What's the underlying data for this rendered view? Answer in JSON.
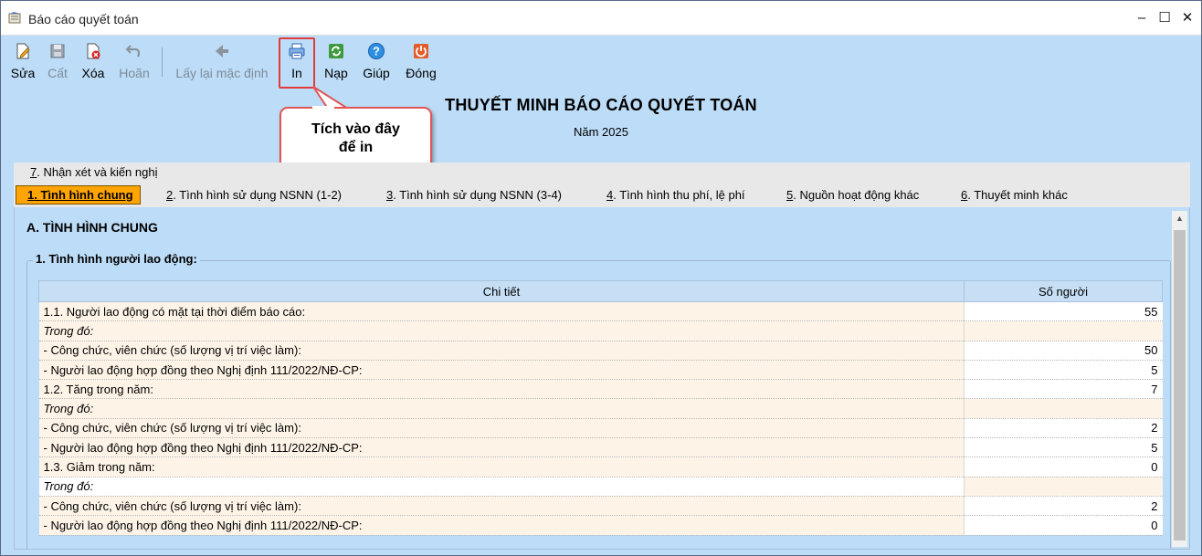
{
  "window": {
    "title": "Báo cáo quyết toán",
    "controls": {
      "minimize": "–",
      "maximize": "☐",
      "close": "✕"
    }
  },
  "toolbar": {
    "buttons": [
      {
        "label": "Sửa",
        "icon": "edit-icon",
        "enabled": true
      },
      {
        "label": "Cất",
        "icon": "save-icon",
        "enabled": false
      },
      {
        "label": "Xóa",
        "icon": "delete-icon",
        "enabled": true
      },
      {
        "label": "Hoãn",
        "icon": "undo-icon",
        "enabled": false
      },
      {
        "label": "Lấy lại mặc định",
        "icon": "reset-default-icon",
        "enabled": false
      },
      {
        "label": "In",
        "icon": "printer-icon",
        "enabled": true
      },
      {
        "label": "Nạp",
        "icon": "refresh-icon",
        "enabled": true
      },
      {
        "label": "Giúp",
        "icon": "help-icon",
        "enabled": true
      },
      {
        "label": "Đóng",
        "icon": "power-icon",
        "enabled": true
      }
    ]
  },
  "callout": {
    "line1": "Tích vào đây",
    "line2": "để in"
  },
  "report": {
    "title": "THUYẾT MINH BÁO CÁO QUYẾT TOÁN",
    "year": "Năm 2025"
  },
  "tabs": [
    {
      "key": "1",
      "rest": ". Tình hình chung",
      "active": true
    },
    {
      "key": "2",
      "rest": ". Tình hình sử dụng NSNN (1-2)",
      "active": false
    },
    {
      "key": "3",
      "rest": ". Tình hình sử dụng NSNN (3-4)",
      "active": false
    },
    {
      "key": "4",
      "rest": ". Tình hình thu phí, lệ phí",
      "active": false
    },
    {
      "key": "5",
      "rest": ". Nguồn hoạt động khác",
      "active": false
    },
    {
      "key": "6",
      "rest": ". Thuyết minh khác",
      "active": false
    },
    {
      "key": "7",
      "rest": ". Nhận xét và kiến nghị",
      "active": false
    }
  ],
  "section": {
    "title": "A. TÌNH HÌNH CHUNG",
    "group_label": "1. Tình hình người lao động:"
  },
  "table": {
    "headers": {
      "detail": "Chi tiết",
      "count": "Số người"
    },
    "rows": [
      {
        "label": "1.1. Người lao động có mặt tại thời điểm báo cáo:",
        "value": "55"
      },
      {
        "label": "Trong đó:",
        "value": ""
      },
      {
        "label": "- Công chức, viên chức (số lượng vị trí việc làm):",
        "value": "50"
      },
      {
        "label": "- Người lao động hợp đồng theo Nghị định 111/2022/NĐ-CP:",
        "value": "5"
      },
      {
        "label": "1.2. Tăng trong năm:",
        "value": "7"
      },
      {
        "label": "Trong đó:",
        "value": ""
      },
      {
        "label": "- Công chức, viên chức (số lượng vị trí việc làm):",
        "value": "2"
      },
      {
        "label": "- Người lao động hợp đồng theo Nghị định 111/2022/NĐ-CP:",
        "value": "5"
      },
      {
        "label": "1.3. Giảm trong năm:",
        "value": "0"
      },
      {
        "label": "Trong đó:",
        "value": ""
      },
      {
        "label": "- Công chức, viên chức (số lượng vị trí việc làm):",
        "value": "2"
      },
      {
        "label": "- Người lao động hợp đồng theo Nghị định 111/2022/NĐ-CP:",
        "value": "0"
      }
    ]
  }
}
